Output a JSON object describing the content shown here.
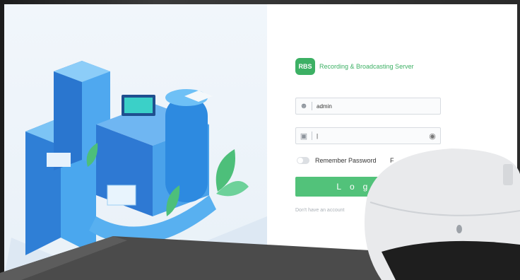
{
  "app": {
    "logo_text": "RBS",
    "name": "Recording & Broadcasting Server"
  },
  "login": {
    "username_value": "admin",
    "password_value": "|",
    "remember_label": "Remember Password",
    "forgot_label": "F",
    "login_button": "Login",
    "signup_text": "Don't have an account"
  },
  "colors": {
    "brand_green": "#3cb064",
    "button_green": "#52c27a"
  },
  "icons": {
    "username": "user-icon",
    "password": "lock-icon",
    "show_password": "eye-icon"
  }
}
